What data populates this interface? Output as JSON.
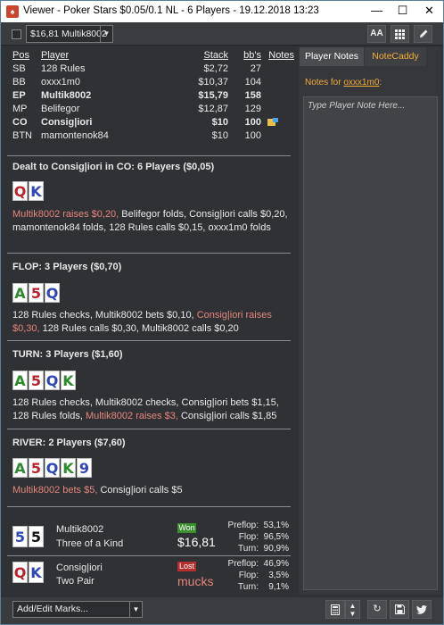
{
  "window": {
    "title": "Viewer - Poker Stars $0.05/0.1 NL - 6 Players - 19.12.2018 13:23",
    "controls": {
      "minimize": "—",
      "maximize": "☐",
      "close": "✕"
    }
  },
  "toolbar": {
    "hand_select": "$16,81 Multik8002",
    "font_button": "AA"
  },
  "players_table": {
    "headers": {
      "pos": "Pos",
      "player": "Player",
      "stack": "Stack",
      "bbs": "bb's",
      "notes": "Notes"
    },
    "rows": [
      {
        "pos": "SB",
        "player": "128 Rules",
        "stack": "$2,72",
        "bbs": "27",
        "bold": false,
        "note": false
      },
      {
        "pos": "BB",
        "player": "oxxx1m0",
        "stack": "$10,37",
        "bbs": "104",
        "bold": false,
        "note": false
      },
      {
        "pos": "EP",
        "player": "Multik8002",
        "stack": "$15,79",
        "bbs": "158",
        "bold": true,
        "note": false
      },
      {
        "pos": "MP",
        "player": "Belifegor",
        "stack": "$12,87",
        "bbs": "129",
        "bold": false,
        "note": false
      },
      {
        "pos": "CO",
        "player": "Consig|iori",
        "stack": "$10",
        "bbs": "100",
        "bold": true,
        "note": true
      },
      {
        "pos": "BTN",
        "player": "mamontenok84",
        "stack": "$10",
        "bbs": "100",
        "bold": false,
        "note": false
      }
    ]
  },
  "preflop": {
    "title": "Dealt to Consig|iori in CO: 6 Players ($0,05)",
    "cards": [
      {
        "rank": "Q",
        "suit": "hearts"
      },
      {
        "rank": "K",
        "suit": "diamonds"
      }
    ],
    "action_hl": "Multik8002 raises $0,20,",
    "action_rest": " Belifegor folds, Consig|iori calls $0,20, mamontenok84 folds, 128 Rules calls $0,15, oxxx1m0 folds"
  },
  "flop": {
    "title": "FLOP: 3 Players ($0,70)",
    "cards": [
      {
        "rank": "A",
        "suit": "clubs"
      },
      {
        "rank": "5",
        "suit": "hearts"
      },
      {
        "rank": "Q",
        "suit": "diamonds"
      }
    ],
    "action_a": "128 Rules checks, Multik8002 bets $0,10, ",
    "action_hl": "Consig|iori raises $0,30,",
    "action_b": " 128 Rules calls $0,30, Multik8002 calls $0,20"
  },
  "turn": {
    "title": "TURN: 3 Players ($1,60)",
    "cards": [
      {
        "rank": "A",
        "suit": "clubs"
      },
      {
        "rank": "5",
        "suit": "hearts"
      },
      {
        "rank": "Q",
        "suit": "diamonds"
      },
      {
        "rank": "K",
        "suit": "clubs"
      }
    ],
    "action_a": "128 Rules checks, Multik8002 checks, Consig|iori bets $1,15, 128 Rules folds, ",
    "action_hl": "Multik8002 raises $3,",
    "action_b": " Consig|iori calls $1,85"
  },
  "river": {
    "title": "RIVER: 2 Players ($7,60)",
    "cards": [
      {
        "rank": "A",
        "suit": "clubs"
      },
      {
        "rank": "5",
        "suit": "hearts"
      },
      {
        "rank": "Q",
        "suit": "diamonds"
      },
      {
        "rank": "K",
        "suit": "clubs"
      },
      {
        "rank": "9",
        "suit": "diamonds"
      }
    ],
    "action_hl": "Multik8002 bets $5,",
    "action_rest": " Consig|iori calls $5"
  },
  "results": [
    {
      "player": "Multik8002",
      "hand": "Three of a Kind",
      "cards": [
        {
          "rank": "5",
          "suit": "diamonds"
        },
        {
          "rank": "5",
          "suit": "spades"
        }
      ],
      "badge": "Won",
      "amount": "$16,81",
      "stats": [
        {
          "label": "Preflop:",
          "value": "53,1%"
        },
        {
          "label": "Flop:",
          "value": "96,5%"
        },
        {
          "label": "Turn:",
          "value": "90,9%"
        }
      ]
    },
    {
      "player": "Consig|iori",
      "hand": "Two Pair",
      "cards": [
        {
          "rank": "Q",
          "suit": "hearts"
        },
        {
          "rank": "K",
          "suit": "diamonds"
        }
      ],
      "badge": "Lost",
      "amount": "mucks",
      "stats": [
        {
          "label": "Preflop:",
          "value": "46,9%"
        },
        {
          "label": "Flop:",
          "value": "3,5%"
        },
        {
          "label": "Turn:",
          "value": "9,1%"
        }
      ]
    }
  ],
  "right_panel": {
    "tabs": [
      "Player Notes",
      "NoteCaddy"
    ],
    "notes_for_label": "Notes for ",
    "notes_for_player": "oxxx1m0",
    "notes_for_suffix": ":",
    "note_placeholder": "Type Player Note Here..."
  },
  "bottom_bar": {
    "marks_select": "Add/Edit Marks..."
  },
  "colors": {
    "background": "#2f3134",
    "highlight_action": "#e5867e",
    "notecaddy_tab": "#f0ad3a",
    "won_badge": "#3b8f2f",
    "lost_badge": "#b52d2d"
  }
}
